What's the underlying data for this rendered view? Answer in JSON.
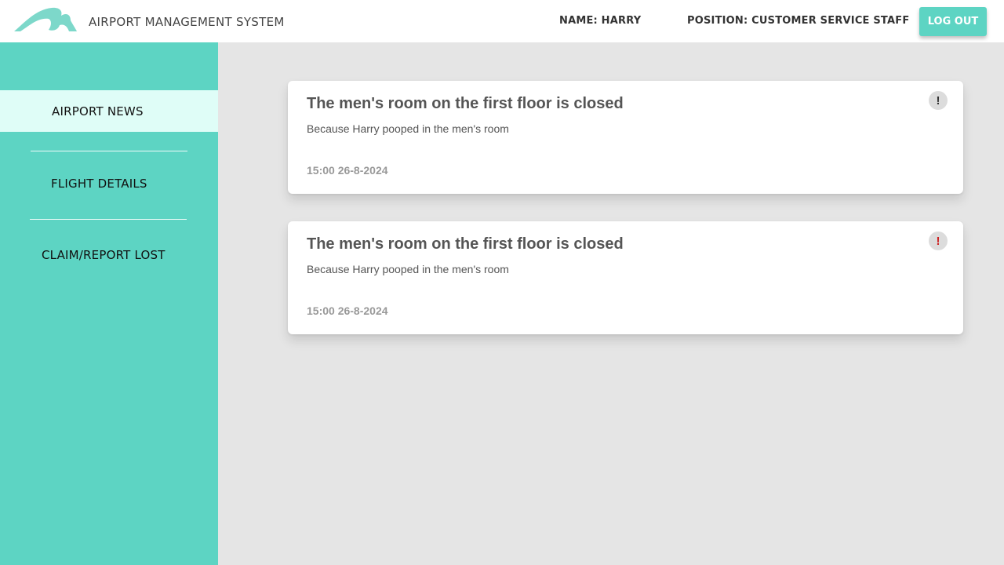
{
  "header": {
    "app_title": "AIRPORT MANAGEMENT SYSTEM",
    "user_name": "NAME: HARRY",
    "user_position": "POSITION: CUSTOMER SERVICE STAFF",
    "logout_label": "LOG OUT",
    "logo_icon": "wave-logo-icon"
  },
  "sidebar": {
    "items": [
      {
        "label": "AIRPORT NEWS",
        "active": true
      },
      {
        "label": "FLIGHT DETAILS",
        "active": false
      },
      {
        "label": "CLAIM/REPORT LOST",
        "active": false
      }
    ]
  },
  "news": [
    {
      "title": "The men's room on the first floor is closed",
      "description": "Because Harry pooped in the men's room",
      "time": "15:00 26-8-2024",
      "alert_symbol": "!",
      "alert_color": "#333333"
    },
    {
      "title": "The men's room on the first floor is closed",
      "description": "Because Harry pooped in the men's room",
      "time": "15:00 26-8-2024",
      "alert_symbol": "!",
      "alert_color": "#cc2222"
    }
  ],
  "colors": {
    "accent": "#5dd4c3",
    "active_nav": "#dffdf7",
    "background": "#e5e5e5"
  }
}
